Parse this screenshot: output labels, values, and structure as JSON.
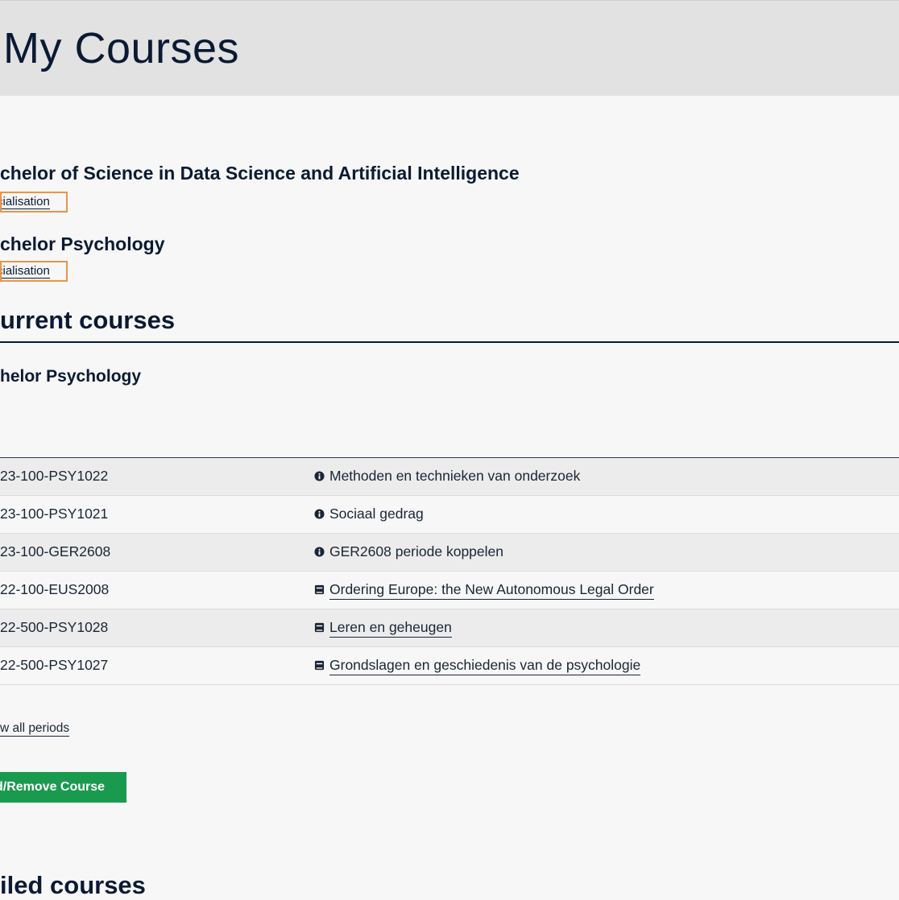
{
  "header": {
    "title": "My Courses"
  },
  "programs": [
    {
      "name": "chelor of Science in Data Science and Artificial Intelligence",
      "specialisation_link": "cialisation"
    },
    {
      "name": "chelor Psychology",
      "specialisation_link": "cialisation"
    }
  ],
  "current_courses": {
    "heading": "urrent courses",
    "program": "helor Psychology",
    "rows": [
      {
        "code": "23-100-PSY1022",
        "icon": "info-circle-icon",
        "title": "Methoden en technieken van onderzoek",
        "is_link": false
      },
      {
        "code": "23-100-PSY1021",
        "icon": "info-circle-icon",
        "title": "Sociaal gedrag",
        "is_link": false
      },
      {
        "code": "23-100-GER2608",
        "icon": "info-circle-icon",
        "title": "GER2608 periode koppelen",
        "is_link": false
      },
      {
        "code": "22-100-EUS2008",
        "icon": "book-icon",
        "title": "Ordering Europe: the New Autonomous Legal Order",
        "is_link": true
      },
      {
        "code": "22-500-PSY1028",
        "icon": "book-icon",
        "title": "Leren en geheugen",
        "is_link": true
      },
      {
        "code": "22-500-PSY1027",
        "icon": "book-icon",
        "title": "Grondslagen en geschiedenis van de psychologie",
        "is_link": true
      }
    ],
    "show_all_link": "w all periods",
    "add_remove_button": "d/Remove Course"
  },
  "failed_courses": {
    "heading": "iled courses"
  },
  "colors": {
    "text": "#0b1a33",
    "header_bg": "#e2e2e2",
    "page_bg": "#f7f7f7",
    "focus_outline": "#e8954a",
    "button_green": "#1a9a4e",
    "row_alt_bg": "#ececec"
  }
}
